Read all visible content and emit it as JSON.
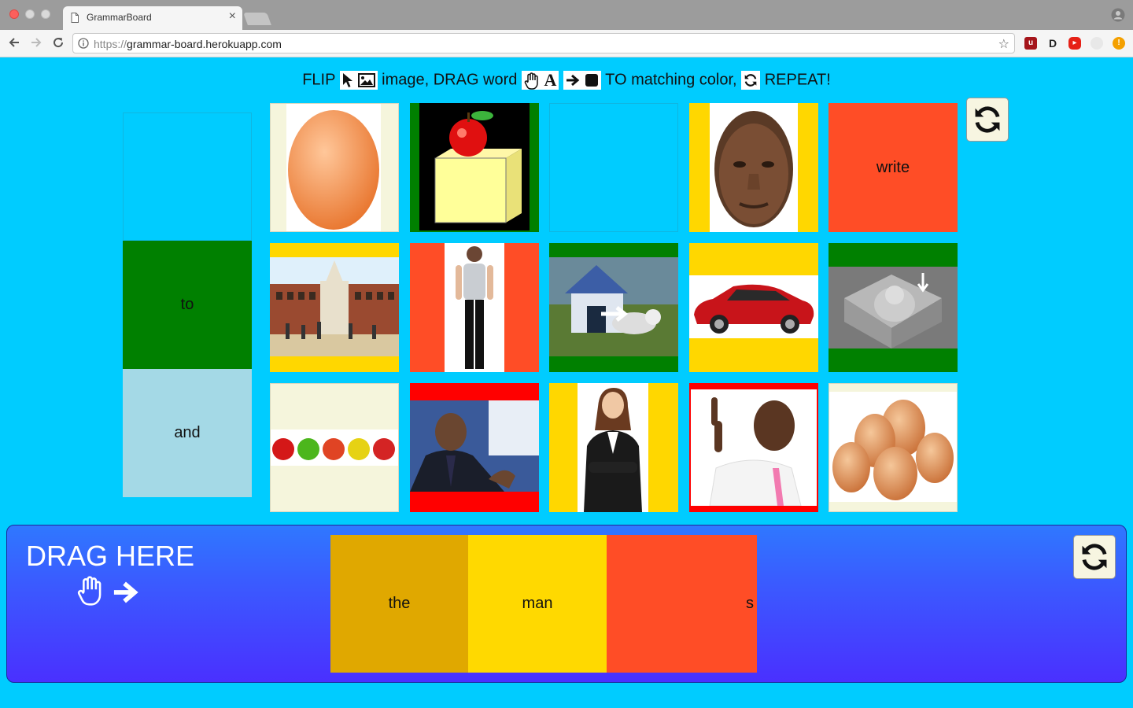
{
  "browser": {
    "tab_title": "GrammarBoard",
    "tab_close": "×",
    "url_scheme": "https://",
    "url_host": "grammar-board.herokuapp.com",
    "star": "☆",
    "extensions": [
      "ublock-origin-icon",
      "disconnect-icon",
      "youtube-icon",
      "generic-extension-icon",
      "alert-extension-icon"
    ]
  },
  "instructions": {
    "flip": "FLIP",
    "image": "image, DRAG word",
    "to_matching": "TO matching color,",
    "repeat": "REPEAT!",
    "letter_a": "A"
  },
  "word_column": {
    "cells": [
      {
        "label": "",
        "color": "#00ccff"
      },
      {
        "label": "to",
        "color": "#008000"
      },
      {
        "label": "and",
        "color": "#a4d9e6"
      }
    ]
  },
  "grid": {
    "cards": [
      {
        "name": "egg",
        "type": "image",
        "frame_color": "#f5f5dc"
      },
      {
        "name": "apple-on-box",
        "type": "image",
        "frame_color": "#008000"
      },
      {
        "name": "empty",
        "type": "empty",
        "frame_color": "#00ccff"
      },
      {
        "name": "kanye-face",
        "type": "image",
        "frame_color": "#ffd700"
      },
      {
        "name": "write",
        "type": "word",
        "label": "write",
        "frame_color": "#ff4d26"
      },
      {
        "name": "school-building",
        "type": "image",
        "frame_color": "#ffd700"
      },
      {
        "name": "woman-standing",
        "type": "image",
        "frame_color": "#ff4d26"
      },
      {
        "name": "dog-doghouse",
        "type": "image",
        "frame_color": "#008000"
      },
      {
        "name": "red-car",
        "type": "image",
        "frame_color": "#ffd700"
      },
      {
        "name": "cat-in-box",
        "type": "image",
        "frame_color": "#008000"
      },
      {
        "name": "row-of-apples",
        "type": "image",
        "frame_color": "#f5f5dc"
      },
      {
        "name": "obama",
        "type": "image",
        "frame_color": "#ff0000"
      },
      {
        "name": "businesswoman",
        "type": "image",
        "frame_color": "#ffd700"
      },
      {
        "name": "man-pointing-up",
        "type": "image",
        "frame_color": "#ff0000"
      },
      {
        "name": "eggs",
        "type": "image",
        "frame_color": "#f5f5dc"
      }
    ]
  },
  "drag_area": {
    "title": "DRAG HERE",
    "slots": [
      {
        "label": "the",
        "color": "#e0a800"
      },
      {
        "label": "man",
        "color": "#ffd900"
      },
      {
        "label": "s",
        "color": "#ff4d26"
      }
    ]
  },
  "colors": {
    "page_background": "#00ccff",
    "green": "#008000",
    "yellow": "#ffd700",
    "orange_red": "#ff4d26",
    "red": "#ff0000",
    "beige": "#f5f5dc"
  }
}
